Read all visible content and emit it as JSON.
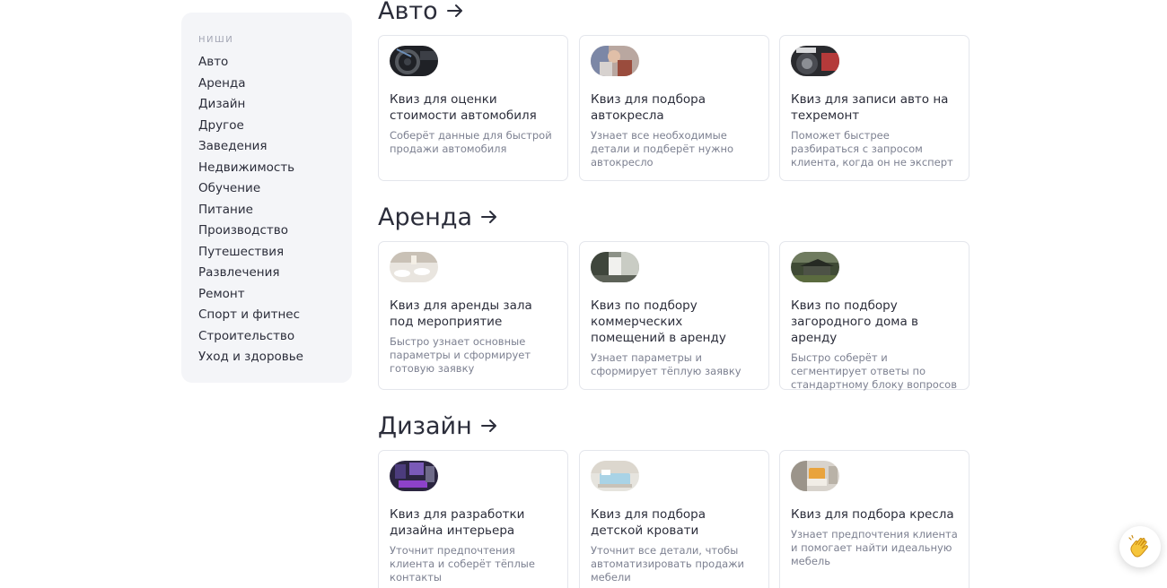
{
  "sidebar": {
    "heading": "НИШИ",
    "items": [
      "Авто",
      "Аренда",
      "Дизайн",
      "Другое",
      "Заведения",
      "Недвижимость",
      "Обучение",
      "Питание",
      "Производство",
      "Путешествия",
      "Развлечения",
      "Ремонт",
      "Спорт и фитнес",
      "Строительство",
      "Уход и здоровье"
    ]
  },
  "sections": [
    {
      "title": "Авто",
      "cards": [
        {
          "title": "Квиз для оценки стоимости автомобиля",
          "desc": "Соберёт данные для быстрой продажи автомобиля",
          "image": "car-dashboard-photo"
        },
        {
          "title": "Квиз для подбора автокресла",
          "desc": "Узнает все необходимые детали и подберёт нужно автокресло",
          "image": "child-car-seat-photo"
        },
        {
          "title": "Квиз для записи авто на техремонт",
          "desc": "Поможет быстрее разбираться с запросом клиента, когда он не эксперт",
          "image": "car-repair-photo"
        }
      ]
    },
    {
      "title": "Аренда",
      "cards": [
        {
          "title": "Квиз для аренды зала под мероприятие",
          "desc": "Быстро узнает основные параметры и сформирует готовую заявку",
          "image": "event-hall-photo"
        },
        {
          "title": "Квиз по подбору коммерческих помещений в аренду",
          "desc": "Узнает параметры и сформирует тёплую заявку",
          "image": "office-space-photo"
        },
        {
          "title": "Квиз по подбору загородного дома в аренду",
          "desc": "Быстро соберёт и сегментирует ответы по стандартному блоку вопросов",
          "image": "country-house-photo"
        }
      ]
    },
    {
      "title": "Дизайн",
      "cards": [
        {
          "title": "Квиз для разработки дизайна интерьера",
          "desc": "Уточнит предпочтения клиента и соберёт тёплые контакты",
          "image": "purple-interior-photo"
        },
        {
          "title": "Квиз для подбора детской кровати",
          "desc": "Уточнит все детали, чтобы автоматизировать продажи мебели",
          "image": "kids-bed-photo"
        },
        {
          "title": "Квиз для подбора кресла",
          "desc": "Узнает предпочтения клиента и помогает найти идеальную мебель",
          "image": "armchair-photo"
        }
      ]
    }
  ],
  "widget": {
    "icon": "waving-hand-icon"
  }
}
